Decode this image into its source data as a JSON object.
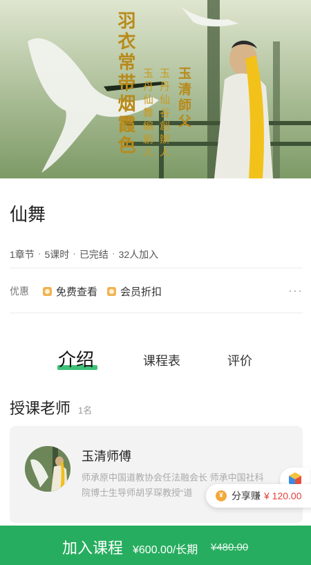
{
  "banner": {
    "vertical_main": "羽衣常带烟霞色",
    "vertical_sub1": "玉清師父",
    "vertical_sub2": "玉丹仙谷創辦人",
    "vertical_sub3": "玉丹仙舞編創人"
  },
  "course": {
    "title": "仙舞",
    "meta": [
      "1章节",
      "5课时",
      "已完结",
      "32人加入"
    ],
    "meta_separator": "·"
  },
  "promo": {
    "label": "优惠",
    "tags": [
      "免费查看",
      "会员折扣"
    ],
    "more": "···"
  },
  "tabs": [
    "介绍",
    "课程表",
    "评价"
  ],
  "teacher_section": {
    "title": "授课老师",
    "count": "1名",
    "teacher": {
      "name": "玉清师傅",
      "desc_line1": "师承原中国道教协会任法融会长 师承中国社科",
      "desc_line2": "院博士生导师胡孚琛教授“道"
    }
  },
  "share": {
    "coin": "¥",
    "label": "分享赚",
    "amount": "¥ 120.00"
  },
  "bottom_bar": {
    "join": "加入课程",
    "price": "¥600.00/长期",
    "old_price": "¥480.00"
  },
  "colors": {
    "accent": "#27ad5f",
    "tab_underline": "#3fc17a",
    "share_amount": "#e0413a",
    "coin": "#f2a93b"
  }
}
